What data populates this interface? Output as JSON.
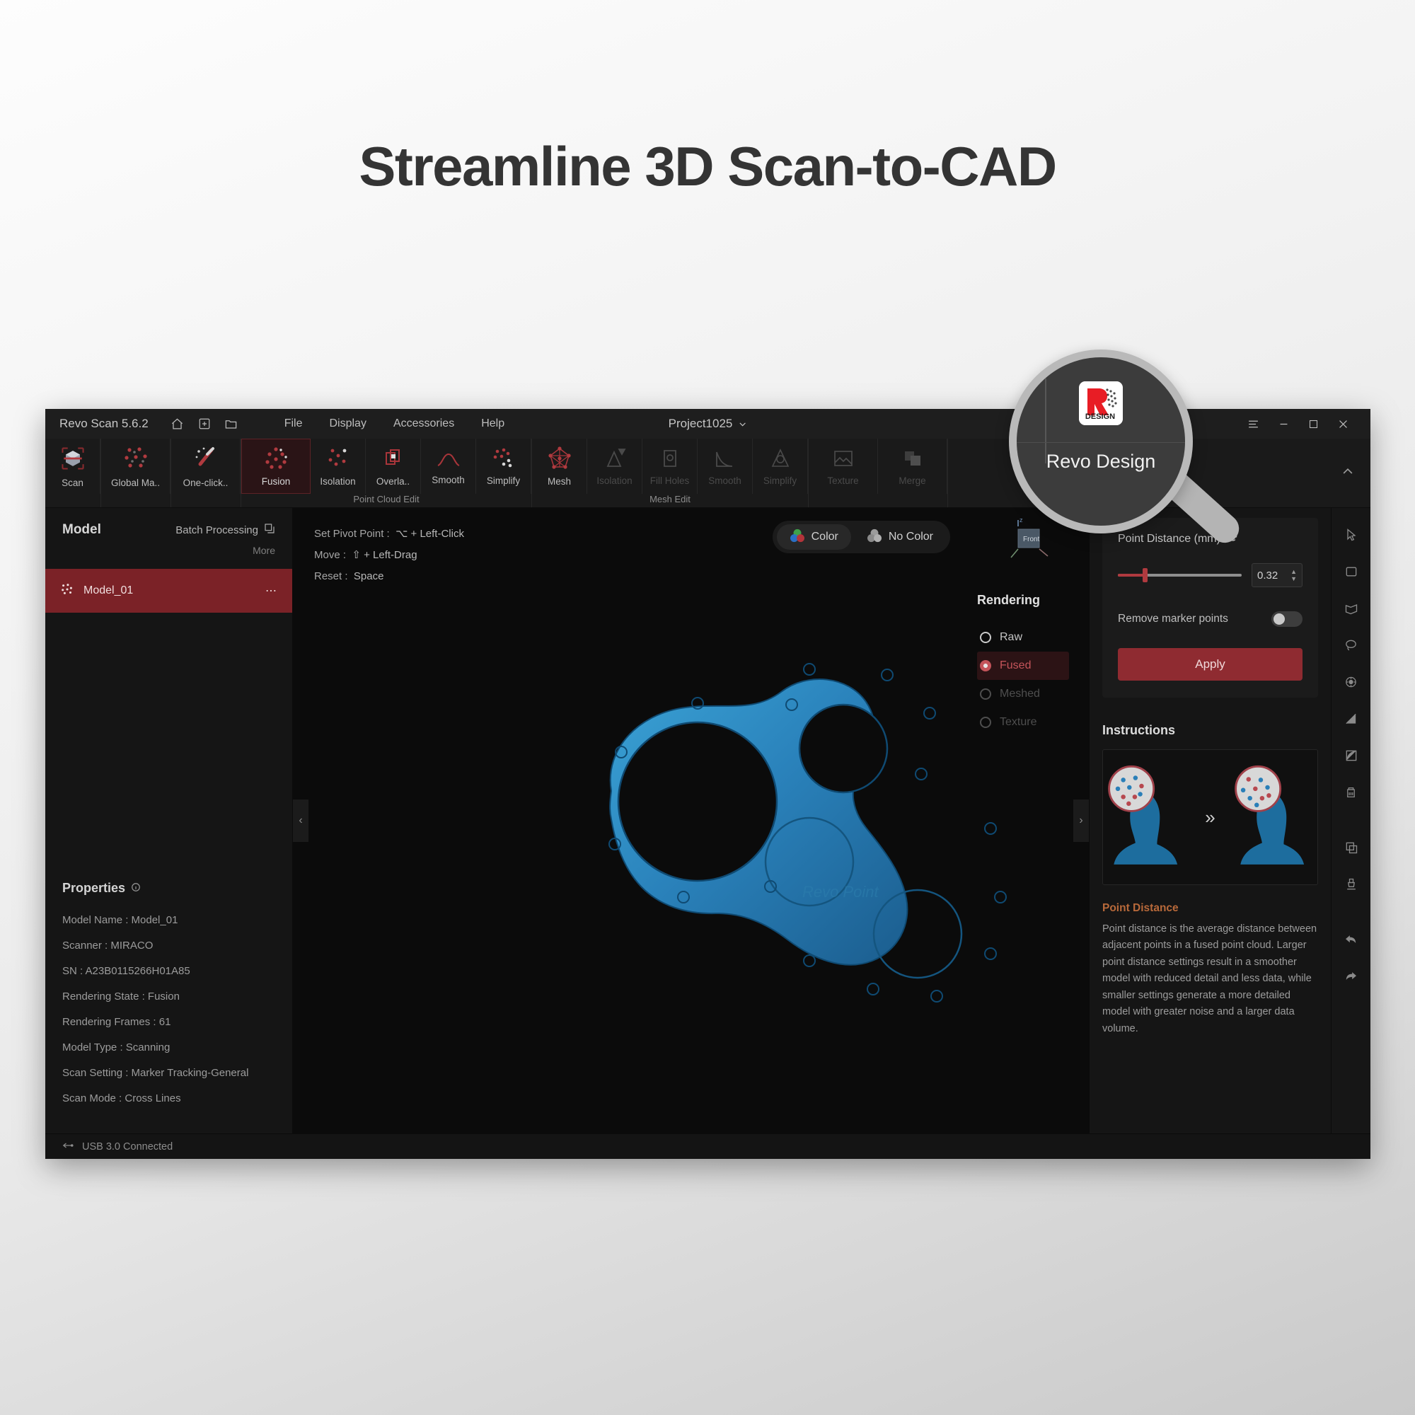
{
  "headline": "Streamline 3D Scan-to-CAD",
  "app": {
    "titlebar": {
      "app_name": "Revo Scan 5.6.2",
      "icons": [
        "home-icon",
        "new-project-icon",
        "open-folder-icon"
      ],
      "menus": [
        "File",
        "Display",
        "Accessories",
        "Help"
      ],
      "project_name": "Project1025",
      "window_controls": [
        "menu-icon",
        "minimize-icon",
        "maximize-icon",
        "close-icon"
      ]
    },
    "ribbon": {
      "groups": [
        {
          "label": "",
          "buttons": [
            {
              "label": "Scan",
              "icon": "scan-cube-icon",
              "state": "normal"
            }
          ]
        },
        {
          "label": "",
          "buttons": [
            {
              "label": "Global Ma..",
              "icon": "global-markers-icon",
              "state": "normal"
            }
          ]
        },
        {
          "label": "",
          "buttons": [
            {
              "label": "One-click..",
              "icon": "magic-wand-icon",
              "state": "normal"
            }
          ]
        },
        {
          "label": "Point Cloud Edit",
          "buttons": [
            {
              "label": "Fusion",
              "icon": "fusion-points-icon",
              "state": "selected"
            },
            {
              "label": "Isolation",
              "icon": "isolation-points-icon",
              "state": "normal"
            },
            {
              "label": "Overla..",
              "icon": "overlap-icon",
              "state": "normal"
            },
            {
              "label": "Smooth",
              "icon": "smooth-curve-icon",
              "state": "normal"
            },
            {
              "label": "Simplify",
              "icon": "simplify-points-icon",
              "state": "normal"
            }
          ]
        },
        {
          "label": "Mesh Edit",
          "buttons": [
            {
              "label": "Mesh",
              "icon": "mesh-icon",
              "state": "normal"
            },
            {
              "label": "Isolation",
              "icon": "mesh-isolation-icon",
              "state": "disabled"
            },
            {
              "label": "Fill Holes",
              "icon": "fill-holes-icon",
              "state": "disabled"
            },
            {
              "label": "Smooth",
              "icon": "mesh-smooth-icon",
              "state": "disabled"
            },
            {
              "label": "Simplify",
              "icon": "mesh-simplify-icon",
              "state": "disabled"
            }
          ]
        },
        {
          "label": "",
          "buttons": [
            {
              "label": "Texture",
              "icon": "texture-icon",
              "state": "disabled"
            },
            {
              "label": "Merge",
              "icon": "merge-icon",
              "state": "disabled"
            }
          ]
        }
      ],
      "collapse_icon": "chevron-up-icon"
    },
    "left_panel": {
      "title": "Model",
      "batch_label": "Batch Processing",
      "batch_icon": "batch-icon",
      "more_label": "More",
      "model_item": {
        "name": "Model_01",
        "icon": "point-cloud-icon",
        "menu_icon": "more-dots-icon"
      },
      "properties_title": "Properties",
      "properties_icon": "info-icon",
      "properties": [
        "Model Name : Model_01",
        "Scanner : MIRACO",
        "SN : A23B0115266H01A85",
        "Rendering State : Fusion",
        "Rendering Frames : 61",
        "Model Type : Scanning",
        "Scan Setting : Marker Tracking-General",
        "Scan Mode : Cross Lines"
      ]
    },
    "viewport": {
      "hints": [
        {
          "key": "Set Pivot Point :",
          "value": "⌥ + Left-Click"
        },
        {
          "key": "Move :",
          "value": "⇧ + Left-Drag"
        },
        {
          "key": "Reset :",
          "value": "Space"
        }
      ],
      "color_toggle": {
        "options": [
          {
            "label": "Color",
            "icon": "color-circles-icon",
            "active": true
          },
          {
            "label": "No Color",
            "icon": "gray-circles-icon",
            "active": false
          }
        ]
      },
      "axis_label": "Front",
      "left_arrow_icon": "chevron-left-icon",
      "right_arrow_icon": "chevron-right-icon",
      "rendering": {
        "title": "Rendering",
        "options": [
          {
            "label": "Raw",
            "state": "normal"
          },
          {
            "label": "Fused",
            "state": "selected"
          },
          {
            "label": "Meshed",
            "state": "disabled"
          },
          {
            "label": "Texture",
            "state": "disabled"
          }
        ]
      }
    },
    "right_panel": {
      "point_distance_label": "Point Distance (mm)",
      "reset_icon": "reset-icon",
      "point_distance_value": "0.32",
      "slider_fill_percent": 22,
      "remove_marker_label": "Remove marker points",
      "remove_marker_on": false,
      "apply_label": "Apply",
      "instructions_title": "Instructions",
      "instruction_arrow": "»",
      "help_title": "Point Distance",
      "help_text": "Point distance is the average distance between adjacent points in a fused point cloud. Larger point distance settings result in a smoother model with reduced detail and less data, while smaller settings generate a more detailed model with greater noise and a larger data volume.",
      "accent_color": "#b8693a"
    },
    "icon_bar": [
      "cursor-select-icon",
      "rectangle-select-icon",
      "polygon-select-icon",
      "lasso-select-icon",
      "brush-select-icon",
      "gradient-icon",
      "invert-selection-icon",
      "delete-clipboard-icon",
      "duplicate-icon",
      "paint-brush-icon",
      "undo-icon",
      "redo-icon"
    ],
    "status_bar": {
      "icon": "usb-icon",
      "text": "USB 3.0 Connected"
    }
  },
  "magnifier": {
    "logo_letter": "R",
    "logo_word": "DESIGN",
    "label": "Revo Design"
  },
  "colors": {
    "accent_red": "#8f2b31",
    "model_blue": "#1f6f9e",
    "panel_bg": "#151515"
  }
}
